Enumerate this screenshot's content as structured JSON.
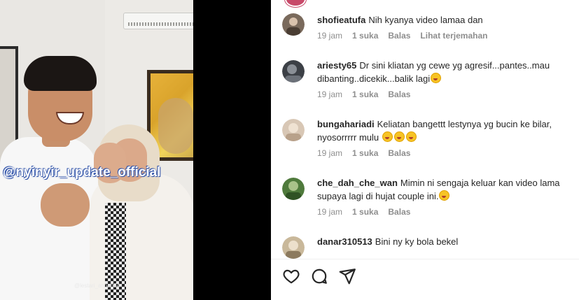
{
  "video": {
    "watermark": "@nyinyir_update_official",
    "credit": "@lestari_annah24"
  },
  "comments": [
    {
      "username": "shofieatufa",
      "text": "Nih kyanya video lamaa dan",
      "time": "19 jam",
      "likes": "1 suka",
      "reply": "Balas",
      "translate": "Lihat terjemahan",
      "avatar_color": "#7a6a5c"
    },
    {
      "username": "ariesty65",
      "text": "Dr sini kliatan yg cewe yg agresif...pantes..mau dibanting..dicekik...balik lagi",
      "emojis": 1,
      "time": "19 jam",
      "likes": "1 suka",
      "reply": "Balas",
      "avatar_color": "#3c4046"
    },
    {
      "username": "bungahariadi",
      "text": "Keliatan bangettt lestynya yg bucin ke bilar, nyosorrrrr mulu",
      "emojis": 3,
      "time": "19 jam",
      "likes": "1 suka",
      "reply": "Balas",
      "avatar_color": "#d8c7b5"
    },
    {
      "username": "che_dah_che_wan",
      "text": "Mimin ni sengaja keluar kan video lama supaya lagi di hujat couple ini.",
      "emojis": 1,
      "time": "19 jam",
      "likes": "1 suka",
      "reply": "Balas",
      "avatar_color": "#4f7a3c"
    },
    {
      "username": "danar310513",
      "text": "Bini ny ky bola bekel",
      "avatar_color": "#c9b89a"
    }
  ],
  "actions": {
    "like_icon": "heart-icon",
    "comment_icon": "comment-icon",
    "share_icon": "share-icon"
  },
  "colors": {
    "text": "#262626",
    "meta": "#8e8e8e",
    "background": "#ffffff",
    "video_bg": "#000000"
  }
}
